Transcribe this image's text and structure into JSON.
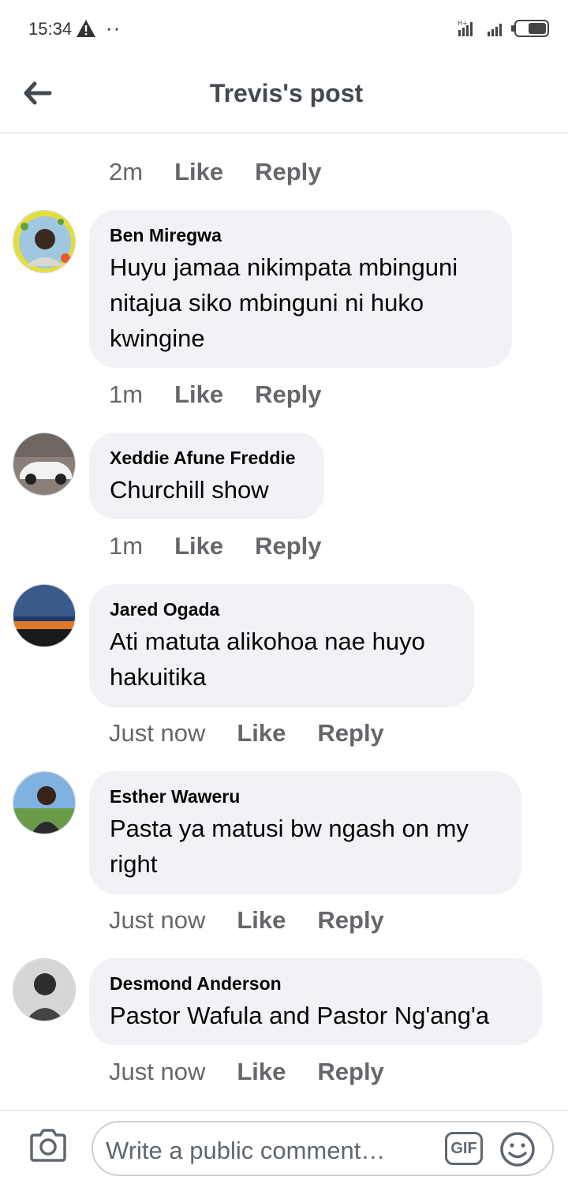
{
  "status_bar": {
    "time": "15:34",
    "icons": [
      "warning-icon",
      "notification-dots-icon",
      "signal-icon",
      "battery-icon"
    ]
  },
  "header": {
    "title": "Trevis's post",
    "back_icon": "back-arrow-icon"
  },
  "top_meta": {
    "time": "2m",
    "like": "Like",
    "reply": "Reply"
  },
  "comments": [
    {
      "author": "Ben Miregwa",
      "lines": [
        "Huyu jamaa nikimpata mbinguni",
        "nitajua siko mbinguni ni huko",
        "kwingine"
      ],
      "time": "1m",
      "like": "Like",
      "reply": "Reply"
    },
    {
      "author": "Xeddie Afune Freddie",
      "lines": [
        "Churchill show"
      ],
      "time": "1m",
      "like": "Like",
      "reply": "Reply"
    },
    {
      "author": "Jared Ogada",
      "lines": [
        "Ati matuta alikohoa nae huyo",
        "hakuitika"
      ],
      "time": "Just now",
      "like": "Like",
      "reply": "Reply"
    },
    {
      "author": "Esther Waweru",
      "lines": [
        "Pasta ya matusi bw ngash on my",
        "right"
      ],
      "time": "Just now",
      "like": "Like",
      "reply": "Reply"
    },
    {
      "author": "Desmond Anderson",
      "lines": [
        "Pastor Wafula and Pastor Ng'ang'a"
      ],
      "time": "Just now",
      "like": "Like",
      "reply": "Reply"
    }
  ],
  "composer": {
    "placeholder": "Write a public comment…",
    "gif_label": "GIF",
    "icons": [
      "camera-icon",
      "gif-icon",
      "emoji-icon"
    ]
  },
  "colors": {
    "bubble": "#f0f2f5",
    "meta_text": "#65676b",
    "title_text": "#444950"
  }
}
